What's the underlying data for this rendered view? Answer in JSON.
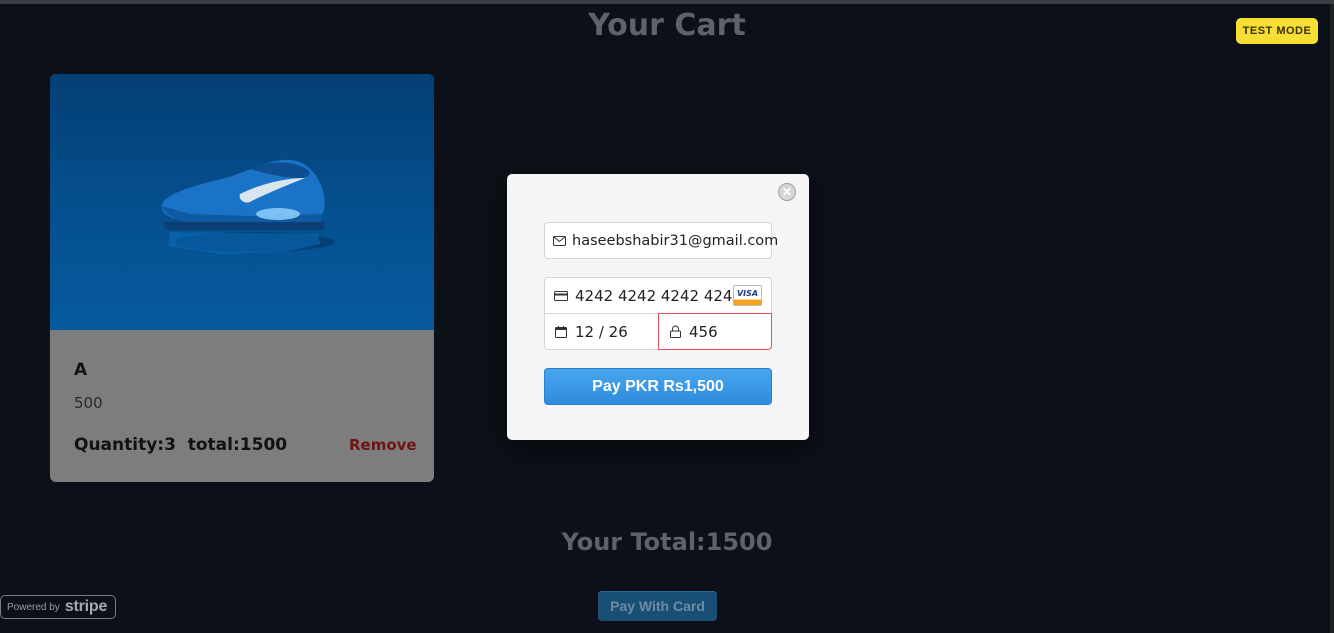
{
  "page": {
    "title": "Your Cart",
    "test_badge": "TEST MODE",
    "your_total": "Your Total:1500",
    "pay_with_card": "Pay With Card"
  },
  "cart": {
    "items": [
      {
        "name": "A",
        "price": "500",
        "quantity_total": "Quantity:3  total:1500",
        "remove_label": "Remove",
        "image_icon": "sneaker-image"
      }
    ]
  },
  "stripe": {
    "powered_by": "Powered by",
    "brand": "stripe"
  },
  "checkout_modal": {
    "email_value": "haseebshabir31@gmail.com",
    "card_number_value": "4242 4242 4242 4242",
    "card_brand": "VISA",
    "expiry_value": "12 / 26",
    "cvc_value": "456",
    "pay_button_label": "Pay PKR Rs1,500",
    "close_icon": "close-icon"
  },
  "colors": {
    "background": "#0c1119",
    "test_badge": "#f6de35",
    "pay_button": "#2f8cdd",
    "remove": "#6f1313",
    "cvc_error_border": "#e0525a"
  }
}
